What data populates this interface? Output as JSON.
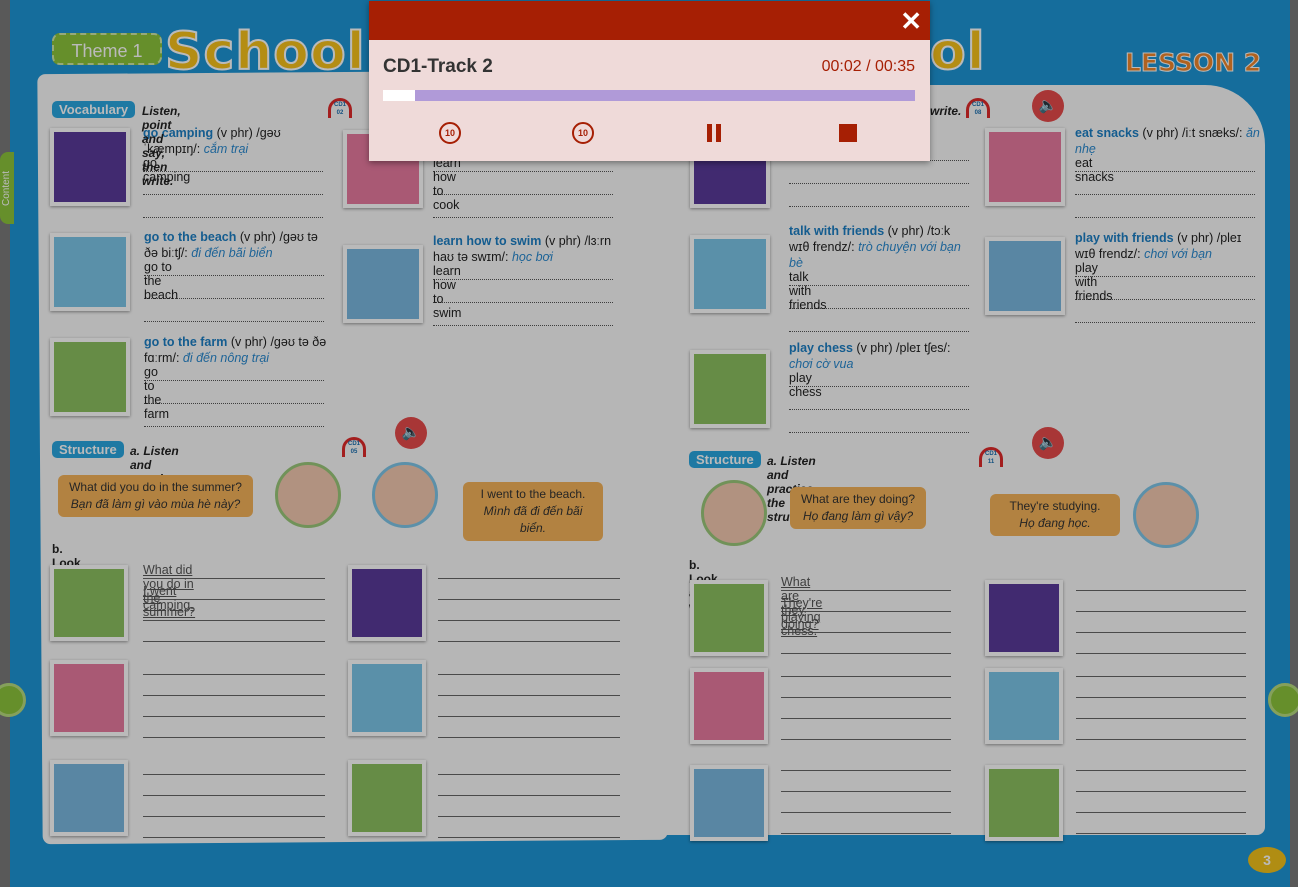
{
  "book": {
    "theme_label": "Theme 1",
    "unit_title": "School",
    "lesson_label": "LESSON 2",
    "page_number": "3",
    "content_tab": "Content",
    "left": {
      "vocab_tag": "Vocabulary",
      "vocab_instruction": "Listen, point and say, then write.",
      "vocab_cd": "CD1 02",
      "vocab": [
        {
          "word": "go camping",
          "pos": "(v phr)",
          "ipa": "/gəʊ ˈkæmpɪŋ/:",
          "meaning": "cắm trại",
          "answer": "go camping"
        },
        {
          "word": "go to the beach",
          "pos": "(v phr)",
          "ipa": "/gəʊ tə ðə biːtʃ/:",
          "meaning": "đi đến bãi biển",
          "answer": "go to the beach"
        },
        {
          "word": "go to the farm",
          "pos": "(v phr)",
          "ipa": "/gəʊ tə ðə fɑːrm/:",
          "meaning": "đi đến nông trại",
          "answer": "go to the farm"
        },
        {
          "word": "",
          "pos": "",
          "ipa": "",
          "meaning": "",
          "answer": "learn how to cook"
        },
        {
          "word": "learn how to swim",
          "pos": "(v phr)",
          "ipa": "/lɜːrn haʊ tə swɪm/:",
          "meaning": "học bơi",
          "answer": "learn how to swim"
        }
      ],
      "structure_tag": "Structure",
      "structure_instruction": "a. Listen and practice the structure.",
      "structure_cd": "CD1 05",
      "bubble_q": {
        "en": "What did you do in the summer?",
        "vi": "Bạn đã làm gì vào mùa hè này?"
      },
      "bubble_a": {
        "en": "I went to the beach.",
        "vi": "Mình đã đi đến bãi biển."
      },
      "look_write": "b. Look and write.",
      "example": [
        "What did you do in the summer?",
        "I went camping."
      ]
    },
    "right": {
      "vocab_instruction": "write.",
      "vocab_cd": "CD1 08",
      "vocab": [
        {
          "word": "",
          "pos": "",
          "ipa": "",
          "meaning": "",
          "answer": ""
        },
        {
          "word": "talk with friends",
          "pos": "(v phr)",
          "ipa": "/tɔːk wɪθ frendz/:",
          "meaning": "trò chuyện với bạn bè",
          "answer": "talk with friends"
        },
        {
          "word": "play chess",
          "pos": "(v phr)",
          "ipa": "/pleɪ tʃes/:",
          "meaning": "chơi cờ vua",
          "answer": "play chess"
        },
        {
          "word": "eat snacks",
          "pos": "(v phr)",
          "ipa": "/iːt snæks/:",
          "meaning": "ăn nhẹ",
          "answer": "eat snacks"
        },
        {
          "word": "play with friends",
          "pos": "(v phr)",
          "ipa": "/pleɪ wɪθ frendz/:",
          "meaning": "chơi với bạn",
          "answer": "play with friends"
        }
      ],
      "structure_tag": "Structure",
      "structure_instruction": "a. Listen and practice the structure.",
      "structure_cd": "CD1 11",
      "bubble_q": {
        "en": "What are they doing?",
        "vi": "Họ đang làm gì vậy?"
      },
      "bubble_a": {
        "en": "They're studying.",
        "vi": "Họ đang học."
      },
      "look_write": "b. Look and write.",
      "example": [
        "What are they doing?",
        "They're playing chess."
      ]
    },
    "speaker_icon": "speaker-icon"
  },
  "player": {
    "track_title": "CD1-Track 2",
    "time": "00:02 / 00:35",
    "progress_fraction": 0.06,
    "close_icon": "✕",
    "accent": "#a61f04",
    "progress_color": "#b09ad8",
    "controls": [
      "rewind-10-icon",
      "forward-10-icon",
      "pause-icon",
      "stop-icon"
    ],
    "rewind_label": "10",
    "forward_label": "10"
  }
}
